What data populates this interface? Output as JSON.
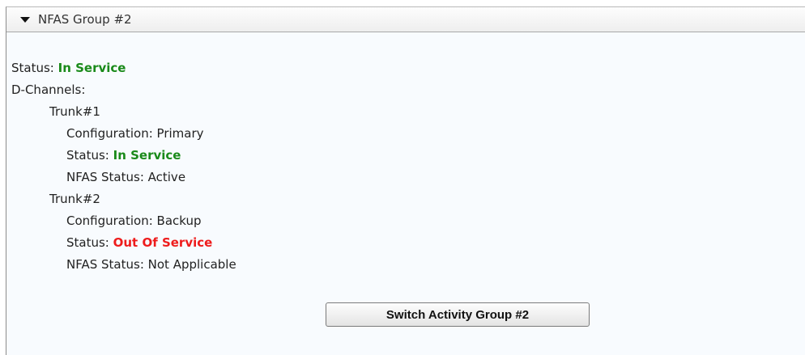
{
  "group": {
    "title": "NFAS Group #2",
    "status_label": "Status: ",
    "status_value": "In Service",
    "dchannels_label": "D-Channels:",
    "switch_button": "Switch Activity Group #2"
  },
  "trunks": [
    {
      "name": "Trunk#1",
      "configuration": "Configuration: Primary",
      "status_label": "Status: ",
      "status_value": "In Service",
      "nfas_status": "NFAS Status: Active"
    },
    {
      "name": "Trunk#2",
      "configuration": "Configuration: Backup",
      "status_label": "Status: ",
      "status_value": "Out Of Service",
      "nfas_status": "NFAS Status: Not Applicable"
    }
  ],
  "colors": {
    "in_service": "#1a8a1a",
    "out_of_service": "#ee1c1c"
  }
}
